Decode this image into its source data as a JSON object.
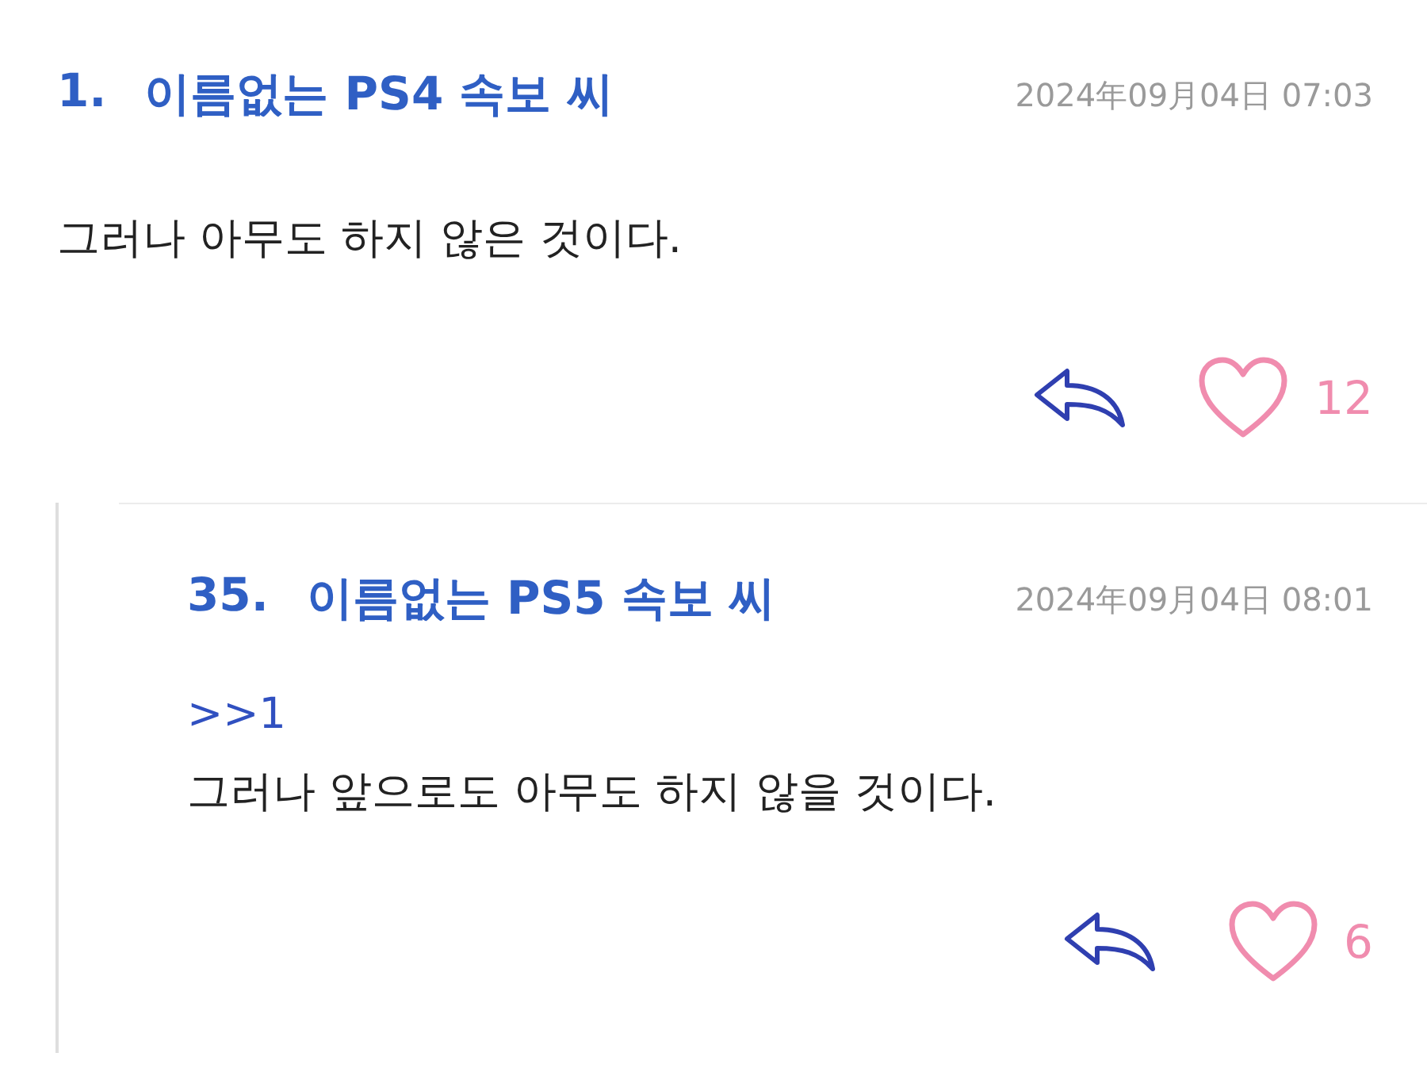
{
  "comments": [
    {
      "number": "1.",
      "author": "이름없는 PS4 속보 씨",
      "date": "2024年09月04日 07:03",
      "lines": [
        {
          "kind": "text",
          "text": "그러나 아무도 하지 않은 것이다."
        }
      ],
      "likes": "12",
      "liked": false,
      "replies": [
        {
          "number": "35.",
          "author": "이름없는 PS5 속보 씨",
          "date": "2024年09月04日 08:01",
          "lines": [
            {
              "kind": "anchor",
              "text": ">>1"
            },
            {
              "kind": "text",
              "text": "그러나 앞으로도 아무도 하지 않을 것이다."
            }
          ],
          "likes": "6",
          "liked": false
        }
      ]
    }
  ]
}
